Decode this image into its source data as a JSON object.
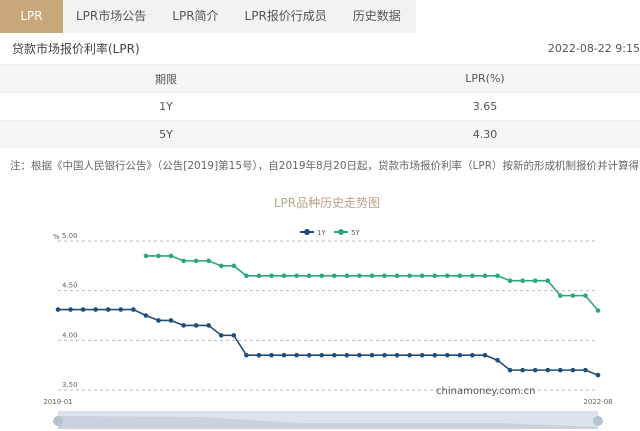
{
  "tabs": [
    "LPR",
    "LPR市场公告",
    "LPR简介",
    "LPR报价行成员",
    "历史数据"
  ],
  "header": {
    "title": "贷款市场报价利率(LPR)",
    "timestamp": "2022-08-22 9:15"
  },
  "table": {
    "headers": [
      "期限",
      "LPR(%)"
    ],
    "rows": [
      [
        "1Y",
        "3.65"
      ],
      [
        "5Y",
        "4.30"
      ]
    ]
  },
  "note": "注：根据《中国人民银行公告》（公告[2019]第15号），自2019年8月20日起，贷款市场报价利率（LPR）按新的形成机制报价并计算得出。",
  "watermark": "chinamoney.com.cn",
  "colors": {
    "accent": "#c8a77a",
    "s1": "#1f4e79",
    "s2": "#2aa876"
  },
  "chart_data": {
    "type": "line",
    "title": "LPR品种历史走势图",
    "ylabel": "%",
    "ylim": [
      3.5,
      5.0
    ],
    "yticks": [
      "5.00",
      "4.50",
      "4.00",
      "3.50"
    ],
    "xticks": [
      "2019-01",
      "2022-08"
    ],
    "grid": true,
    "legend": "top-center",
    "start": "2019-01",
    "months": 44,
    "series": [
      {
        "name": "1Y",
        "values": [
          4.31,
          4.31,
          4.31,
          4.31,
          4.31,
          4.31,
          4.31,
          4.25,
          4.2,
          4.2,
          4.15,
          4.15,
          4.15,
          4.05,
          4.05,
          3.85,
          3.85,
          3.85,
          3.85,
          3.85,
          3.85,
          3.85,
          3.85,
          3.85,
          3.85,
          3.85,
          3.85,
          3.85,
          3.85,
          3.85,
          3.85,
          3.85,
          3.85,
          3.85,
          3.85,
          3.8,
          3.7,
          3.7,
          3.7,
          3.7,
          3.7,
          3.7,
          3.7,
          3.65
        ]
      },
      {
        "name": "5Y",
        "values": [
          null,
          null,
          null,
          null,
          null,
          null,
          null,
          4.85,
          4.85,
          4.85,
          4.8,
          4.8,
          4.8,
          4.75,
          4.75,
          4.65,
          4.65,
          4.65,
          4.65,
          4.65,
          4.65,
          4.65,
          4.65,
          4.65,
          4.65,
          4.65,
          4.65,
          4.65,
          4.65,
          4.65,
          4.65,
          4.65,
          4.65,
          4.65,
          4.65,
          4.65,
          4.6,
          4.6,
          4.6,
          4.6,
          4.45,
          4.45,
          4.45,
          4.3
        ]
      }
    ]
  }
}
